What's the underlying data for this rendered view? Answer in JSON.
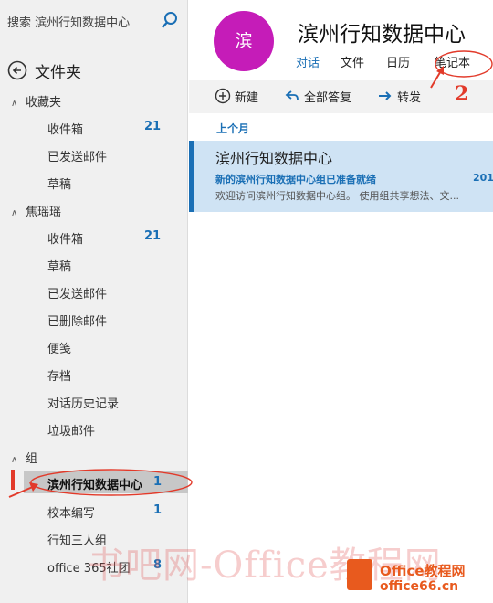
{
  "search": {
    "placeholder": "搜索 滨州行知数据中心"
  },
  "nav": {
    "folders_title": "文件夹"
  },
  "favorites": {
    "label": "收藏夹",
    "items": [
      {
        "label": "收件箱",
        "count": "21"
      },
      {
        "label": "已发送邮件"
      },
      {
        "label": "草稿"
      }
    ]
  },
  "account": {
    "label": "焦瑶瑶",
    "items": [
      {
        "label": "收件箱",
        "count": "21"
      },
      {
        "label": "草稿"
      },
      {
        "label": "已发送邮件"
      },
      {
        "label": "已删除邮件"
      },
      {
        "label": "便笺"
      },
      {
        "label": "存档"
      },
      {
        "label": "对话历史记录"
      },
      {
        "label": "垃圾邮件"
      }
    ]
  },
  "groups": {
    "label": "组",
    "items": [
      {
        "label": "滨州行知数据中心",
        "count": "1"
      },
      {
        "label": "校本编写",
        "count": "1"
      },
      {
        "label": "行知三人组"
      },
      {
        "label": "office 365社团",
        "count": "8"
      }
    ]
  },
  "header": {
    "avatar_text": "滨",
    "title": "滨州行知数据中心",
    "tabs": [
      "对话",
      "文件",
      "日历",
      "笔记本"
    ]
  },
  "toolbar": {
    "new_label": "新建",
    "reply_all_label": "全部答复",
    "forward_label": "转发"
  },
  "list": {
    "section_label": "上个月",
    "message": {
      "sender": "滨州行知数据中心",
      "subject": "新的滨州行知数据中心组已准备就绪",
      "date": "201",
      "preview": "欢迎访问滨州行知数据中心组。 使用组共享想法、文..."
    }
  },
  "annotations": {
    "one": "1",
    "two": "2"
  },
  "watermark": {
    "text": "书吧网-Office教程网",
    "logo_top": "Office教程网",
    "logo_bottom": "office66.cn"
  },
  "colors": {
    "accent": "#1a6fb5",
    "avatar": "#c51cb8",
    "annotation": "#e23a2a",
    "logo": "#e85a1e"
  }
}
